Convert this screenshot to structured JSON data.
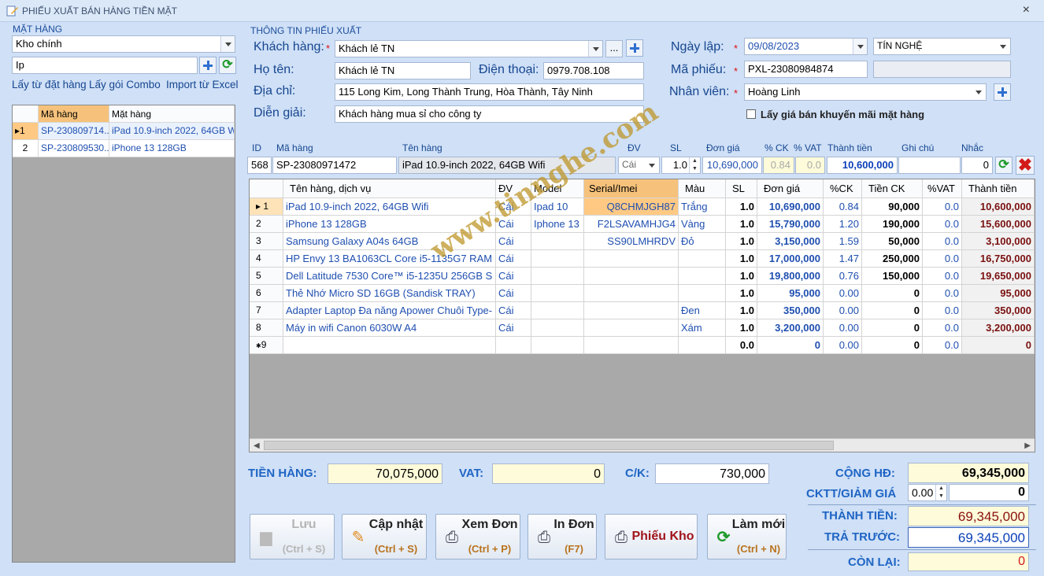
{
  "window": {
    "title": "PHIẾU XUẤT BÁN HÀNG TIỀN MẶT",
    "close": "×"
  },
  "left": {
    "group_label": "MẶT HÀNG",
    "warehouse": "Kho chính",
    "search_value": "Ip",
    "links": [
      "Lấy từ đặt hàng",
      "Lấy gói Combo",
      "Import từ Excel"
    ],
    "grid": {
      "headers": [
        "Mã hàng",
        "Mặt hàng"
      ],
      "rows": [
        {
          "marker": "▸1",
          "code": "SP-230809714...",
          "name": "iPad 10.9-inch 2022, 64GB Wifi"
        },
        {
          "marker": "2",
          "code": "SP-230809530...",
          "name": "iPhone 13 128GB"
        }
      ]
    }
  },
  "info": {
    "group_label": "THÔNG TIN PHIẾU XUẤT",
    "customer_label": "Khách hàng:",
    "customer": "Khách lẻ TN",
    "ellipsis": "...",
    "name_label": "Họ tên:",
    "name": "Khách lẻ TN",
    "phone_label": "Điện thoại:",
    "phone": "0979.708.108",
    "address_label": "Địa chỉ:",
    "address": "115 Long Kim, Long Thành Trung, Hòa Thành, Tây Ninh",
    "note_label": "Diễn giải:",
    "note": "Khách hàng mua sỉ cho công ty",
    "date_label": "Ngày lập:",
    "date": "09/08/2023",
    "creator": "TÍN NGHỆ",
    "code_label": "Mã phiếu:",
    "code": "PXL-23080984874",
    "staff_label": "Nhân viên:",
    "staff": "Hoàng Linh",
    "promo_label": "Lấy giá bán khuyến mãi mặt hàng",
    "required": "*"
  },
  "entry": {
    "headers": {
      "id": "ID",
      "code": "Mã hàng",
      "name": "Tên hàng",
      "unit": "ĐV",
      "qty": "SL",
      "price": "Đơn giá",
      "disc": "% CK",
      "vat": "% VAT",
      "total": "Thành tiền",
      "note": "Ghi chú",
      "remind": "Nhắc"
    },
    "id": "568",
    "code": "SP-23080971472",
    "name": "iPad 10.9-inch 2022, 64GB Wifi",
    "unit": "Cái",
    "qty": "1.0",
    "price": "10,690,000",
    "disc": "0.84",
    "vat": "0.0",
    "total": "10,600,000",
    "note": "",
    "remind": "0"
  },
  "grid": {
    "headers": [
      "Tên hàng, dịch vụ",
      "ĐV",
      "Model",
      "Serial/Imei",
      "Màu",
      "SL",
      "Đơn giá",
      "%CK",
      "Tiền CK",
      "%VAT",
      "Thành tiền"
    ],
    "rows": [
      {
        "no": "1",
        "name": "iPad 10.9-inch 2022, 64GB Wifi",
        "unit": "Cái",
        "model": "Ipad 10",
        "serial": "Q8CHMJGH87",
        "color": "Trắng",
        "qty": "1.0",
        "price": "10,690,000",
        "disc": "0.84",
        "disc_amt": "90,000",
        "vat": "0.0",
        "total": "10,600,000"
      },
      {
        "no": "2",
        "name": "iPhone 13 128GB",
        "unit": "Cái",
        "model": "Iphone 13",
        "serial": "F2LSAVAMHJG4",
        "color": "Vàng",
        "qty": "1.0",
        "price": "15,790,000",
        "disc": "1.20",
        "disc_amt": "190,000",
        "vat": "0.0",
        "total": "15,600,000"
      },
      {
        "no": "3",
        "name": "Samsung Galaxy A04s 64GB",
        "unit": "Cái",
        "model": "",
        "serial": "SS90LMHRDV",
        "color": "Đỏ",
        "qty": "1.0",
        "price": "3,150,000",
        "disc": "1.59",
        "disc_amt": "50,000",
        "vat": "0.0",
        "total": "3,100,000"
      },
      {
        "no": "4",
        "name": "HP Envy 13 BA1063CL Core i5-1135G7 RAM",
        "unit": "Cái",
        "model": "",
        "serial": "",
        "color": "",
        "qty": "1.0",
        "price": "17,000,000",
        "disc": "1.47",
        "disc_amt": "250,000",
        "vat": "0.0",
        "total": "16,750,000"
      },
      {
        "no": "5",
        "name": "Dell Latitude 7530 Core™ i5-1235U 256GB S",
        "unit": "Cái",
        "model": "",
        "serial": "",
        "color": "",
        "qty": "1.0",
        "price": "19,800,000",
        "disc": "0.76",
        "disc_amt": "150,000",
        "vat": "0.0",
        "total": "19,650,000"
      },
      {
        "no": "6",
        "name": "Thẻ Nhớ Micro SD 16GB (Sandisk TRAY)",
        "unit": "Cái",
        "model": "",
        "serial": "",
        "color": "",
        "qty": "1.0",
        "price": "95,000",
        "disc": "0.00",
        "disc_amt": "0",
        "vat": "0.0",
        "total": "95,000"
      },
      {
        "no": "7",
        "name": "Adapter Laptop Đa năng Apower Chuôi Type-",
        "unit": "Cái",
        "model": "",
        "serial": "",
        "color": "Đen",
        "qty": "1.0",
        "price": "350,000",
        "disc": "0.00",
        "disc_amt": "0",
        "vat": "0.0",
        "total": "350,000"
      },
      {
        "no": "8",
        "name": "Máy in wifi Canon 6030W A4",
        "unit": "Cái",
        "model": "",
        "serial": "",
        "color": "Xám",
        "qty": "1.0",
        "price": "3,200,000",
        "disc": "0.00",
        "disc_amt": "0",
        "vat": "0.0",
        "total": "3,200,000"
      },
      {
        "no": "9",
        "name": "",
        "unit": "",
        "model": "",
        "serial": "",
        "color": "",
        "qty": "0.0",
        "price": "0",
        "disc": "0.00",
        "disc_amt": "0",
        "vat": "0.0",
        "total": "0"
      }
    ]
  },
  "totals": {
    "goods_label": "TIỀN HÀNG:",
    "goods": "70,075,000",
    "vat_label": "VAT:",
    "vat": "0",
    "ck_label": "C/K:",
    "ck": "730,000",
    "sum_label": "CỘNG HĐ:",
    "sum": "69,345,000",
    "cktt_label": "CKTT/GIẢM GIÁ",
    "cktt_pct": "0.00",
    "cktt": "0",
    "amount_label": "THÀNH TIỀN:",
    "amount": "69,345,000",
    "prepaid_label": "TRẢ TRƯỚC:",
    "prepaid": "69,345,000",
    "remain_label": "CÒN LẠI:",
    "remain": "0"
  },
  "buttons": {
    "save": {
      "label": "Lưu",
      "key": "(Ctrl + S)"
    },
    "update": {
      "label": "Cập nhật",
      "key": "(Ctrl + S)"
    },
    "view": {
      "label": "Xem Đơn",
      "key": "(Ctrl + P)"
    },
    "print": {
      "label": "In Đơn",
      "key": "(F7)"
    },
    "stock": {
      "label": "Phiếu Kho"
    },
    "renew": {
      "label": "Làm mới",
      "key": "(Ctrl + N)"
    }
  },
  "watermark": "www.tinnghe.com"
}
